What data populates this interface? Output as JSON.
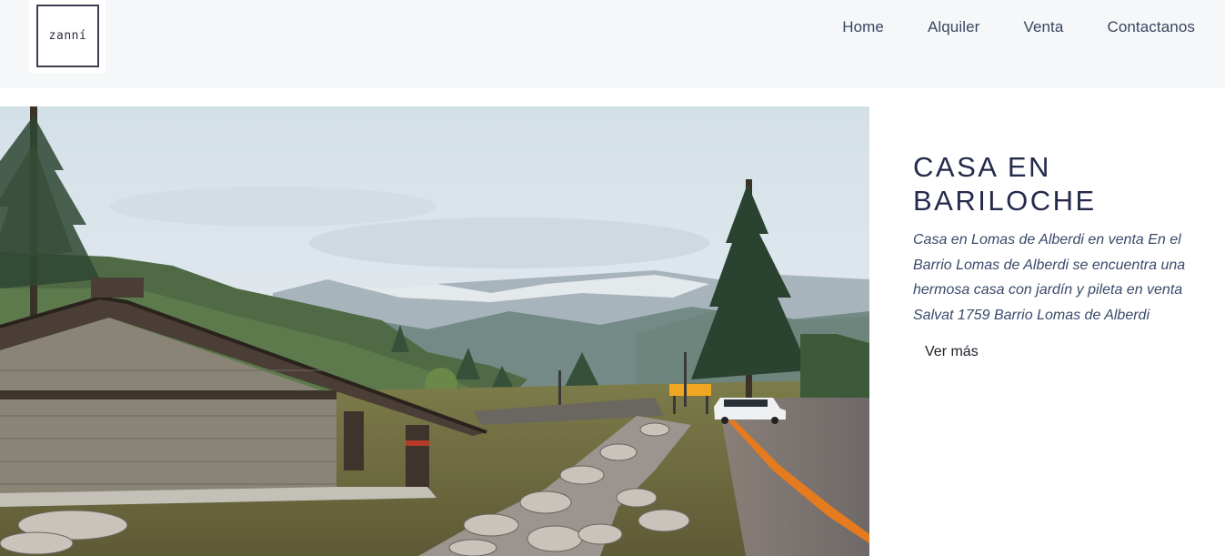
{
  "header": {
    "logo_text": "zanní",
    "nav": [
      "Home",
      "Alquiler",
      "Venta",
      "Contactanos"
    ]
  },
  "listing": {
    "title_line1": "CASA EN",
    "title_line2": "BARILOCHE",
    "description": "Casa en Lomas de Alberdi en venta En el Barrio Lomas de Alberdi se encuentra una hermosa casa con jardín y pileta en venta Salvat 1759 Barrio Lomas de Alberdi",
    "more_label": "Ver más"
  },
  "colors": {
    "header_bg": "#f6f7f9",
    "title": "#232a4a",
    "nav_text": "#3a4660"
  }
}
